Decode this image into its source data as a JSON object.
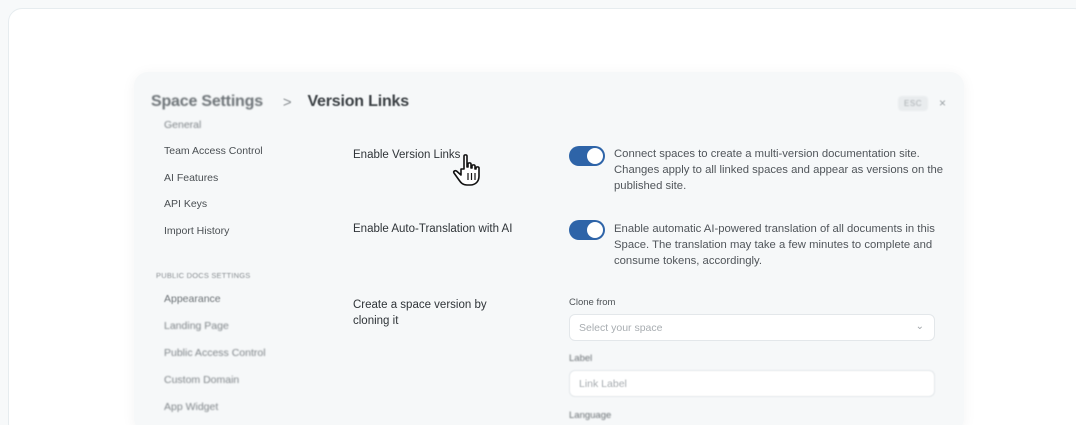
{
  "breadcrumb": {
    "parent": "Space Settings",
    "separator": ">",
    "current": "Version Links"
  },
  "esc_label": "ESC",
  "close_glyph": "×",
  "sidebar": {
    "items_top": [
      "General",
      "Team Access Control",
      "AI Features",
      "API Keys",
      "Import History"
    ],
    "section_heading": "PUBLIC DOCS SETTINGS",
    "items_public": [
      "Appearance",
      "Landing Page",
      "Public Access Control",
      "Custom Domain",
      "App Widget"
    ]
  },
  "settings": {
    "version_links": {
      "label": "Enable Version Links",
      "enabled": true,
      "description": "Connect spaces to create a multi-version documentation site. Changes apply to all linked spaces and appear as versions on the published site."
    },
    "auto_translation": {
      "label": "Enable Auto-Translation with AI",
      "enabled": true,
      "description": "Enable automatic AI-powered translation of all documents in this Space. The translation may take a few minutes to complete and consume tokens, accordingly."
    },
    "clone": {
      "label": "Create a space version by cloning it",
      "clone_from_label": "Clone from",
      "clone_from_placeholder": "Select your space",
      "label_field_label": "Label",
      "label_field_placeholder": "Link Label",
      "language_label": "Language"
    }
  },
  "colors": {
    "toggle_on": "#2e64a8",
    "background": "#f7f9fa"
  },
  "icons": {
    "cursor": "hand-pointer-icon",
    "chevron": "chevron-down-icon",
    "close": "close-icon"
  }
}
